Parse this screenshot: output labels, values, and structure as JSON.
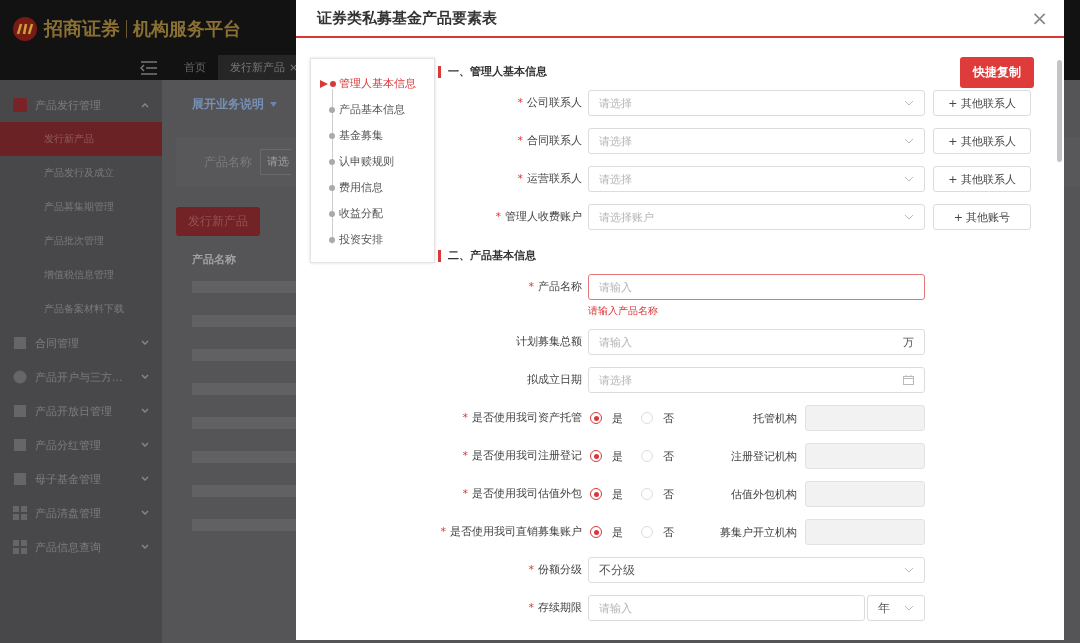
{
  "header": {
    "brand": "招商证券",
    "platform": "机构服务平台"
  },
  "tabbar": {
    "tabs": [
      {
        "label": "首页",
        "selected": false
      },
      {
        "label": "发行新产品",
        "selected": true,
        "close": "×"
      }
    ]
  },
  "sidebar": {
    "groups": [
      {
        "label": "产品发行管理",
        "expanded": true,
        "children": [
          {
            "label": "发行新产品",
            "selected": true
          },
          {
            "label": "产品发行及成立",
            "selected": false
          },
          {
            "label": "产品募集期管理",
            "selected": false
          },
          {
            "label": "产品批次管理",
            "selected": false
          },
          {
            "label": "增值税信息管理",
            "selected": false
          },
          {
            "label": "产品备案材料下载",
            "selected": false
          }
        ]
      },
      {
        "label": "合同管理",
        "expanded": false
      },
      {
        "label": "产品开户与三方...",
        "expanded": false
      },
      {
        "label": "产品开放日管理",
        "expanded": false
      },
      {
        "label": "产品分红管理",
        "expanded": false
      },
      {
        "label": "母子基金管理",
        "expanded": false
      },
      {
        "label": "产品清盘管理",
        "expanded": false
      },
      {
        "label": "产品信息查询",
        "expanded": false
      }
    ]
  },
  "content": {
    "toggle": "展开业务说明",
    "filter_label": "产品名称",
    "filter_placeholder": "请选",
    "new_button": "发行新产品",
    "column": "产品名称"
  },
  "modal": {
    "title": "证券类私募基金产品要素表",
    "close": "×",
    "copy_button": "快捷复制",
    "nav": [
      {
        "label": "管理人基本信息",
        "selected": true
      },
      {
        "label": "产品基本信息",
        "selected": false
      },
      {
        "label": "基金募集",
        "selected": false
      },
      {
        "label": "认申赎规则",
        "selected": false
      },
      {
        "label": "费用信息",
        "selected": false
      },
      {
        "label": "收益分配",
        "selected": false
      },
      {
        "label": "投资安排",
        "selected": false
      }
    ],
    "sections": [
      {
        "title": "一、管理人基本信息",
        "rows": [
          {
            "kind": "select",
            "label": "公司联系人",
            "marker": "*",
            "placeholder": "请选择",
            "action": "+ 其他联系人"
          },
          {
            "kind": "select",
            "label": "合同联系人",
            "marker": "*",
            "placeholder": "请选择",
            "action": "+ 其他联系人"
          },
          {
            "kind": "select",
            "label": "运营联系人",
            "marker": "*",
            "placeholder": "请选择",
            "action": "+ 其他联系人"
          },
          {
            "kind": "select",
            "label": "管理人收费账户",
            "marker": "*",
            "placeholder": "请选择账户",
            "action": "+ 其他账号"
          }
        ]
      },
      {
        "title": "二、产品基本信息",
        "rows": [
          {
            "kind": "input",
            "label": "产品名称",
            "marker": "*",
            "placeholder": "请输入",
            "error": "请输入产品名称"
          },
          {
            "kind": "input",
            "label": "计划募集总额",
            "placeholder": "请输入",
            "suffix": "万"
          },
          {
            "kind": "date",
            "label": "拟成立日期",
            "placeholder": "请选择"
          },
          {
            "kind": "radio",
            "label": "是否使用我司资产托管",
            "marker": "*",
            "options": [
              {
                "label": "是",
                "selected": true
              },
              {
                "label": "否",
                "selected": false
              }
            ],
            "side_label": "托管机构"
          },
          {
            "kind": "radio",
            "label": "是否使用我司注册登记",
            "marker": "*",
            "options": [
              {
                "label": "是",
                "selected": true
              },
              {
                "label": "否",
                "selected": false
              }
            ],
            "side_label": "注册登记机构"
          },
          {
            "kind": "radio",
            "label": "是否使用我司估值外包",
            "marker": "*",
            "options": [
              {
                "label": "是",
                "selected": true
              },
              {
                "label": "否",
                "selected": false
              }
            ],
            "side_label": "估值外包机构"
          },
          {
            "kind": "radio",
            "label": "是否使用我司直销募集账户",
            "marker": "*",
            "options": [
              {
                "label": "是",
                "selected": true
              },
              {
                "label": "否",
                "selected": false
              }
            ],
            "side_label": "募集户开立机构"
          },
          {
            "kind": "select",
            "label": "份额分级",
            "marker": "*",
            "value": "不分级"
          },
          {
            "kind": "period",
            "label": "存续期限",
            "marker": "*",
            "placeholder": "请输入",
            "unit": "年"
          }
        ]
      }
    ]
  }
}
